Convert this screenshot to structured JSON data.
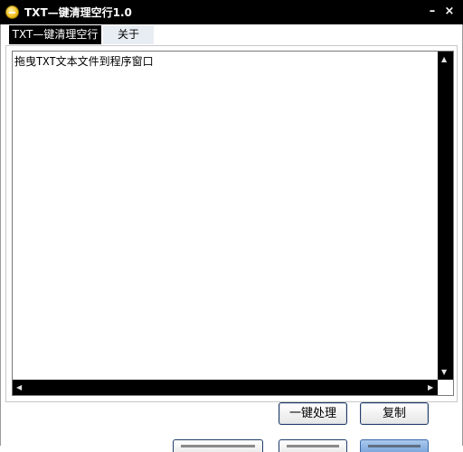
{
  "window": {
    "title": "TXT—键清理空行1.0",
    "minimize_glyph": "–",
    "close_glyph": "×"
  },
  "tabs": [
    {
      "label": "TXT—键清理空行",
      "active": true
    },
    {
      "label": "关于",
      "active": false
    }
  ],
  "editor": {
    "content": "拖曳TXT文本文件到程序窗口"
  },
  "buttons": {
    "process_label": "一键处理",
    "copy_label": "复制"
  },
  "icons": [
    "app-icon",
    "minimize-icon",
    "close-icon",
    "scroll-up-icon",
    "scroll-down-icon",
    "scroll-left-icon",
    "scroll-right-icon"
  ],
  "colors": {
    "titlebar": "#000000",
    "scrollbar": "#000000",
    "button_border": "#1e3c6a",
    "active_tab": "#000000"
  }
}
